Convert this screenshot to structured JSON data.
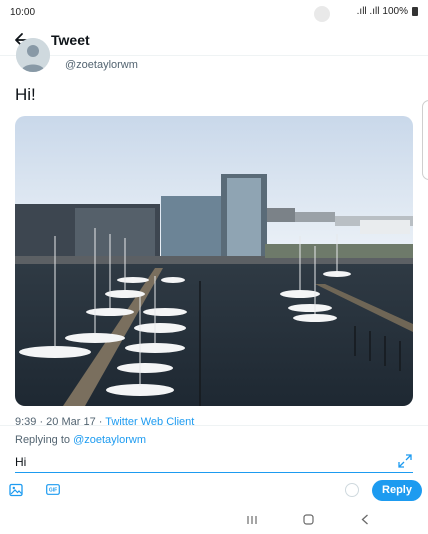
{
  "status_bar": {
    "time": "10:00",
    "signal": ".ıll .ıll",
    "battery": "100%"
  },
  "header": {
    "title": "Tweet"
  },
  "tweet": {
    "handle": "@zoetaylorwm",
    "text": "Hi!",
    "meta_time": "9:39 · 20 Mar 17 · ",
    "meta_client": "Twitter Web Client"
  },
  "composer": {
    "replying_prefix": "Replying to ",
    "replying_mention": "@zoetaylorwm",
    "input_value": "Hi",
    "reply_label": "Reply",
    "gif_label": "GIF"
  },
  "icons": {
    "back": "arrow-left-icon",
    "expand": "expand-icon",
    "image": "image-icon",
    "gif": "gif-icon",
    "nav_recents": "recents-icon",
    "nav_home": "home-icon",
    "nav_back": "chevron-left-icon"
  },
  "colors": {
    "accent": "#1d9bf0",
    "text": "#0f1419",
    "secondary": "#536471"
  }
}
